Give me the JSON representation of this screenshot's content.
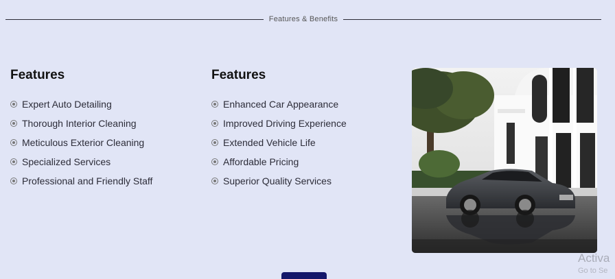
{
  "section_label": "Features & Benefits",
  "left_column": {
    "heading": "Features",
    "items": [
      "Expert Auto Detailing",
      "Thorough Interior Cleaning",
      "Meticulous Exterior Cleaning",
      "Specialized Services",
      "Professional and Friendly Staff"
    ]
  },
  "middle_column": {
    "heading": "Features",
    "items": [
      "Enhanced Car Appearance",
      "Improved Driving Experience",
      "Extended Vehicle Life",
      "Affordable Pricing",
      "Superior Quality Services"
    ]
  },
  "watermark": {
    "title": "Activa",
    "subtitle": "Go to Se"
  },
  "icons": {
    "bullet": "radio-circle-icon"
  },
  "colors": {
    "background": "#e1e5f6",
    "button": "#14176a"
  }
}
